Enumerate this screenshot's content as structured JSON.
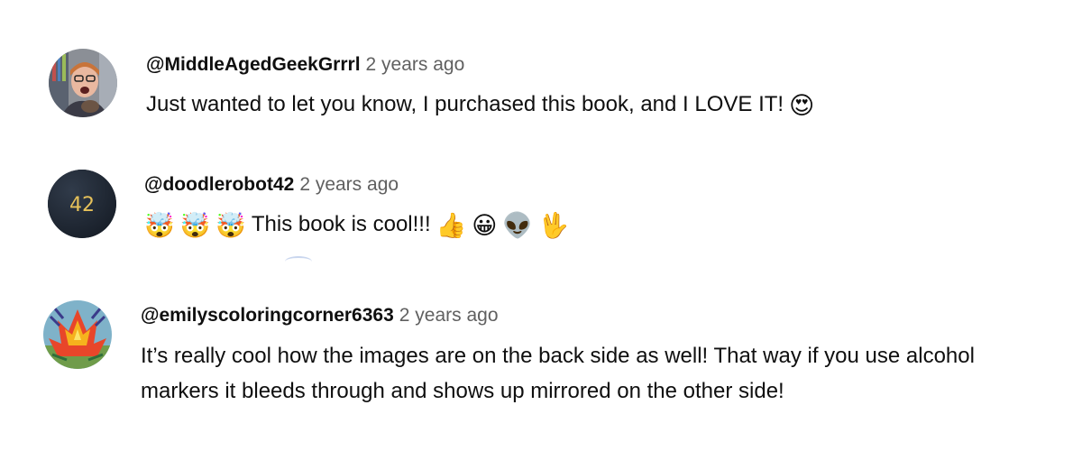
{
  "comments": [
    {
      "handle": "@MiddleAgedGeekGrrrl",
      "time": "2 years ago",
      "text": "Just wanted to let you know, I purchased this book, and I LOVE IT!",
      "trailing_emoji": [
        "😍"
      ]
    },
    {
      "handle": "@doodlerobot42",
      "time": "2 years ago",
      "avatar_text": "42",
      "leading_emoji": [
        "🤯",
        "🤯",
        "🤯"
      ],
      "text": "This book is cool!!!",
      "trailing_emoji": [
        "👍",
        "😀",
        "👽",
        "🖖"
      ]
    },
    {
      "handle": "@emilyscoloringcorner6363",
      "time": "2 years ago",
      "text": "It’s really cool how the images are on the back side as well! That way if you use alcohol markers it bleeds through and shows up mirrored on the other side!"
    }
  ],
  "colors": {
    "handle": "#0f0f0f",
    "timestamp": "#606060",
    "avatar_dark": "#1c2430",
    "avatar_number": "#e6c15a"
  }
}
